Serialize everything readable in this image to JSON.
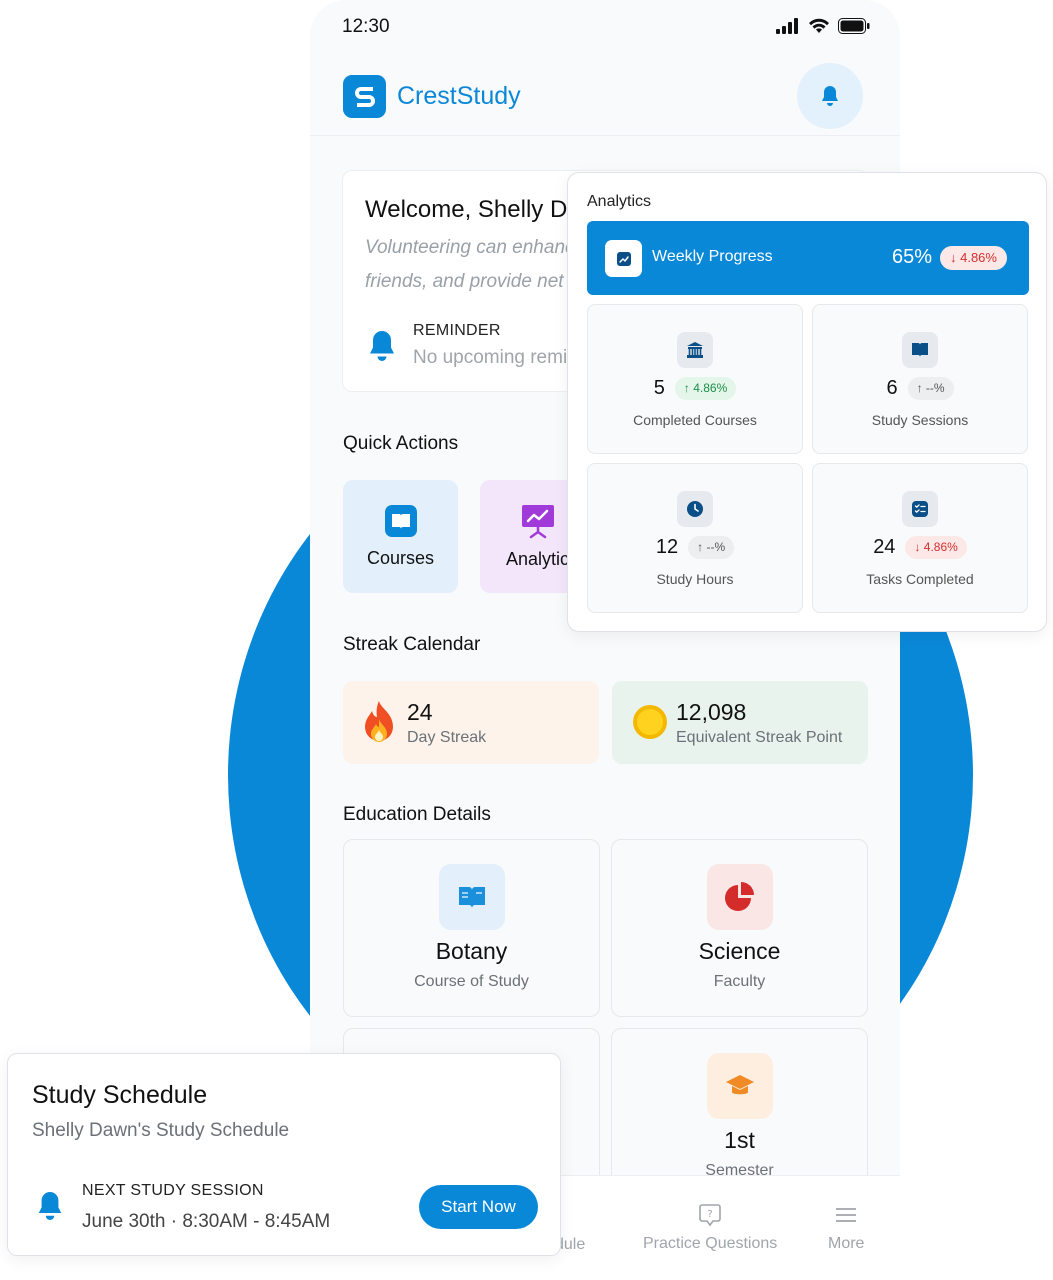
{
  "status": {
    "time": "12:30"
  },
  "brand": {
    "name": "CrestStudy"
  },
  "welcome": {
    "title": "Welcome, Shelly D",
    "quote_line1": "Volunteering can enhance",
    "quote_line2": "friends, and provide net",
    "reminder_title": "REMINDER",
    "reminder_text": "No upcoming remi"
  },
  "quick_actions": {
    "title": "Quick Actions",
    "items": [
      {
        "label": "Courses",
        "icon": "book-icon",
        "color": "#e3f0fb"
      },
      {
        "label": "Analytic",
        "icon": "presentation-chart-icon",
        "color": "#f3e6fb"
      }
    ]
  },
  "streak": {
    "title": "Streak Calendar",
    "day_value": "24",
    "day_label": "Day Streak",
    "points_value": "12,098",
    "points_label": "Equivalent Streak Point"
  },
  "education": {
    "title": "Education Details",
    "items": [
      {
        "value": "Botany",
        "label": "Course of Study",
        "icon": "book-open-icon"
      },
      {
        "value": "Science",
        "label": "Faculty",
        "icon": "pie-chart-icon"
      },
      {
        "value": "1st",
        "label": "Semester",
        "icon": "graduation-cap-icon"
      }
    ]
  },
  "bottom_nav": {
    "items": [
      {
        "label": "dule"
      },
      {
        "label": "Practice Questions",
        "icon": "question-bubble-icon"
      },
      {
        "label": "More",
        "icon": "menu-icon"
      }
    ]
  },
  "analytics": {
    "title": "Analytics",
    "weekly": {
      "label": "Weekly Progress",
      "value": "65%",
      "change": "↓ 4.86%"
    },
    "stats": [
      {
        "value": "5",
        "change": "↑ 4.86%",
        "trend": "up",
        "label": "Completed Courses",
        "icon": "building-icon"
      },
      {
        "value": "6",
        "change": "↑ --%",
        "trend": "neutral",
        "label": "Study Sessions",
        "icon": "book-icon"
      },
      {
        "value": "12",
        "change": "↑ --%",
        "trend": "neutral",
        "label": "Study Hours",
        "icon": "clock-icon"
      },
      {
        "value": "24",
        "change": "↓ 4.86%",
        "trend": "down",
        "label": "Tasks Completed",
        "icon": "checklist-icon"
      }
    ]
  },
  "schedule": {
    "title": "Study Schedule",
    "subtitle": "Shelly Dawn's Study Schedule",
    "next_label": "NEXT STUDY SESSION",
    "next_date": "June 30th · 8:30AM - 8:45AM",
    "start_label": "Start Now"
  },
  "colors": {
    "primary": "#0a88d8",
    "up": "#1e8e4a",
    "down": "#d32f2f"
  }
}
